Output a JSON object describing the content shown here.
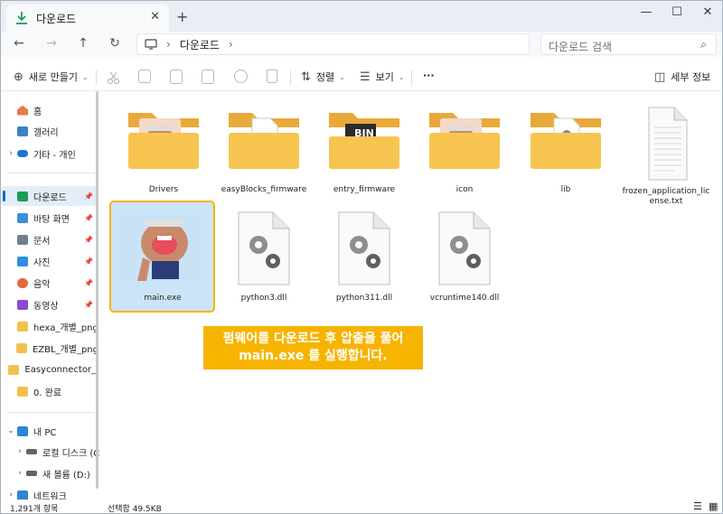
{
  "window": {
    "tab_title": "다운로드",
    "close_glyph": "✕",
    "new_tab_glyph": "+",
    "minimize_glyph": "—",
    "maximize_glyph": "☐",
    "close_window_glyph": "✕"
  },
  "nav": {
    "back_glyph": "←",
    "forward_glyph": "→",
    "up_glyph": "↑",
    "refresh_glyph": "↻",
    "address": {
      "location": "다운로드",
      "sep1": "›",
      "sep2": "›"
    },
    "search_placeholder": "다운로드 검색"
  },
  "toolbar": {
    "new_label": "새로 만들기",
    "sort_label": "정렬",
    "view_label": "보기",
    "more_label": "···",
    "details_label": "세부 정보"
  },
  "sidebar": {
    "items": [
      {
        "label": "홈",
        "icon": "home-icon"
      },
      {
        "label": "갤러리",
        "icon": "gallery-icon"
      },
      {
        "label": "기타 - 개인",
        "icon": "onedrive-icon"
      },
      {
        "label": "다운로드",
        "icon": "download-icon"
      },
      {
        "label": "바탕 화면",
        "icon": "desktop-icon"
      },
      {
        "label": "문서",
        "icon": "document-icon"
      },
      {
        "label": "사진",
        "icon": "pictures-icon"
      },
      {
        "label": "음악",
        "icon": "music-icon"
      },
      {
        "label": "동영상",
        "icon": "video-icon"
      },
      {
        "label": "hexa_개별_png",
        "icon": "folder-icon"
      },
      {
        "label": "EZBL_개별_png",
        "icon": "folder-icon"
      },
      {
        "label": "Easyconnector_I",
        "icon": "folder-icon"
      },
      {
        "label": "0. 완료",
        "icon": "folder-icon"
      },
      {
        "label": "내 PC",
        "icon": "pc-icon"
      },
      {
        "label": "로컬 디스크 (C",
        "icon": "disk-icon"
      },
      {
        "label": "새 볼륨 (D:)",
        "icon": "disk-icon"
      },
      {
        "label": "네트워크",
        "icon": "network-icon"
      }
    ]
  },
  "files": [
    {
      "name": "Drivers",
      "kind": "folder-mascot"
    },
    {
      "name": "easyBlocks_firmware",
      "kind": "folder-doc"
    },
    {
      "name": "entry_firmware",
      "kind": "folder-bin",
      "badge": "BIN"
    },
    {
      "name": "icon",
      "kind": "folder-mascot"
    },
    {
      "name": "lib",
      "kind": "folder-gear"
    },
    {
      "name": "frozen_application_license.txt",
      "name_line1": "frozen_application_lic",
      "name_line2": "ense.txt",
      "kind": "text-file"
    },
    {
      "name": "main.exe",
      "kind": "exe"
    },
    {
      "name": "python3.dll",
      "kind": "dll"
    },
    {
      "name": "python311.dll",
      "kind": "dll"
    },
    {
      "name": "vcruntime140.dll",
      "kind": "dll"
    }
  ],
  "callout": {
    "line1": "펌웨어를 다운로드 후 압출을 풀어",
    "line2": "main.exe 를 실행합니다."
  },
  "status": {
    "count": "1,291개 항목",
    "selected": "선택함 49.5KB"
  },
  "colors": {
    "accent": "#0b6ad0",
    "folder": "#f2c04f",
    "highlight": "#f6b400",
    "selection": "#cce4f7"
  }
}
